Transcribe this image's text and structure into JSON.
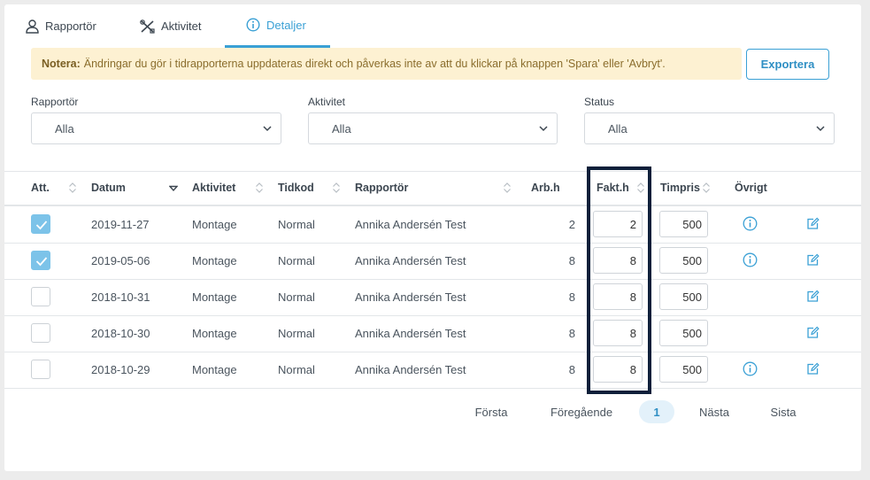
{
  "tabs": [
    {
      "label": "Rapportör",
      "icon": "user-icon"
    },
    {
      "label": "Aktivitet",
      "icon": "tools-icon"
    },
    {
      "label": "Detaljer",
      "icon": "info-icon"
    }
  ],
  "active_tab": "Detaljer",
  "notice": {
    "bold": "Notera:",
    "text": "Ändringar du gör i tidrapporterna uppdateras direkt och påverkas inte av att du klickar på knappen 'Spara' eller 'Avbryt'."
  },
  "export_label": "Exportera",
  "filters": [
    {
      "label": "Rapportör",
      "value": "Alla"
    },
    {
      "label": "Aktivitet",
      "value": "Alla"
    },
    {
      "label": "Status",
      "value": "Alla"
    }
  ],
  "columns": [
    "Att.",
    "Datum",
    "Aktivitet",
    "Tidkod",
    "Rapportör",
    "Arb.h",
    "Fakt.h",
    "Timpris",
    "Övrigt"
  ],
  "rows": [
    {
      "att": true,
      "datum": "2019-11-27",
      "aktivitet": "Montage",
      "tidkod": "Normal",
      "rapportor": "Annika Andersén Test",
      "arbh": "2",
      "fakth": "2",
      "timpris": "500",
      "info": true
    },
    {
      "att": true,
      "datum": "2019-05-06",
      "aktivitet": "Montage",
      "tidkod": "Normal",
      "rapportor": "Annika Andersén Test",
      "arbh": "8",
      "fakth": "8",
      "timpris": "500",
      "info": true
    },
    {
      "att": false,
      "datum": "2018-10-31",
      "aktivitet": "Montage",
      "tidkod": "Normal",
      "rapportor": "Annika Andersén Test",
      "arbh": "8",
      "fakth": "8",
      "timpris": "500",
      "info": false
    },
    {
      "att": false,
      "datum": "2018-10-30",
      "aktivitet": "Montage",
      "tidkod": "Normal",
      "rapportor": "Annika Andersén Test",
      "arbh": "8",
      "fakth": "8",
      "timpris": "500",
      "info": false
    },
    {
      "att": false,
      "datum": "2018-10-29",
      "aktivitet": "Montage",
      "tidkod": "Normal",
      "rapportor": "Annika Andersén Test",
      "arbh": "8",
      "fakth": "8",
      "timpris": "500",
      "info": true
    }
  ],
  "pagination": {
    "first": "Första",
    "prev": "Föregående",
    "current": "1",
    "next": "Nästa",
    "last": "Sista"
  },
  "colors": {
    "accent": "#3aa0d5",
    "notice_bg": "#fdf1d2",
    "highlight_border": "#0e1f3a"
  }
}
